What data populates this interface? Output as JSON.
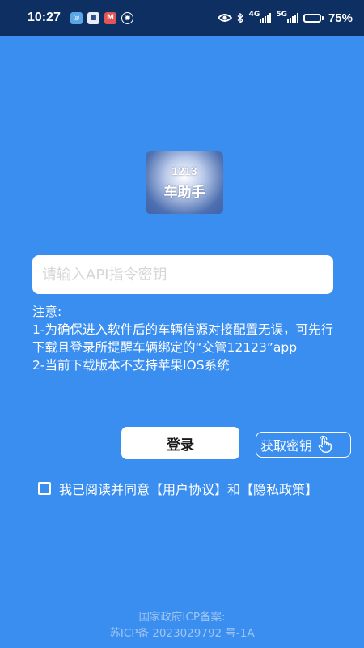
{
  "status_bar": {
    "time": "10:27",
    "network_1": "4G",
    "network_2": "5G",
    "battery": "75%",
    "battery_level": 0.75,
    "icons": [
      "notification-app-icon",
      "notification-app-icon-2",
      "notification-app-icon-3",
      "notification-app-icon-4",
      "eye-icon",
      "bluetooth-icon",
      "signal-icon",
      "signal-icon",
      "battery-icon"
    ]
  },
  "logo": {
    "line1": "1213",
    "line2": "车助手"
  },
  "api_input": {
    "placeholder": "请输入API指令密钥",
    "value": ""
  },
  "notice": {
    "title": "注意:",
    "line1": "1-为确保进入软件后的车辆信源对接配置无误，可先行下载且登录所提醒车辆绑定的“交管12123”app",
    "line2": "2-当前下载版本不支持苹果IOS系统"
  },
  "buttons": {
    "login": "登录",
    "get_key": "获取密钥",
    "get_key_icon": "hand-pointer-icon"
  },
  "agreement": {
    "prefix": "我已阅读并同意",
    "user_agreement": "【用户协议】",
    "conjunction": "和",
    "privacy_policy": "【隐私政策】",
    "checked": false
  },
  "footer": {
    "line1": "国家政府ICP备案:",
    "line2": "苏ICP备 2023029792 号-1A"
  },
  "colors": {
    "background": "#3a8ef0",
    "status_bar": "#0e2f61",
    "footer_text": "#9fc4f2"
  }
}
